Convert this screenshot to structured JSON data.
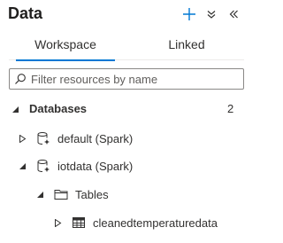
{
  "panel": {
    "title": "Data",
    "icons": {
      "add": "plus-icon",
      "more": "double-chevron-down-icon",
      "collapse": "double-chevron-left-icon"
    }
  },
  "tabs": [
    {
      "label": "Workspace",
      "active": true
    },
    {
      "label": "Linked",
      "active": false
    }
  ],
  "search": {
    "placeholder": "Filter resources by name",
    "value": ""
  },
  "databases": {
    "label": "Databases",
    "count": "2",
    "items": [
      {
        "label": "default (Spark)",
        "expanded": false,
        "icon": "spark-database-icon"
      },
      {
        "label": "iotdata (Spark)",
        "expanded": true,
        "icon": "spark-database-icon",
        "children": [
          {
            "label": "Tables",
            "expanded": true,
            "icon": "folder-icon",
            "children": [
              {
                "label": "cleanedtemperaturedata",
                "expanded": false,
                "icon": "table-icon"
              }
            ]
          }
        ]
      }
    ]
  },
  "colors": {
    "accent": "#0078d4",
    "text": "#323130"
  }
}
